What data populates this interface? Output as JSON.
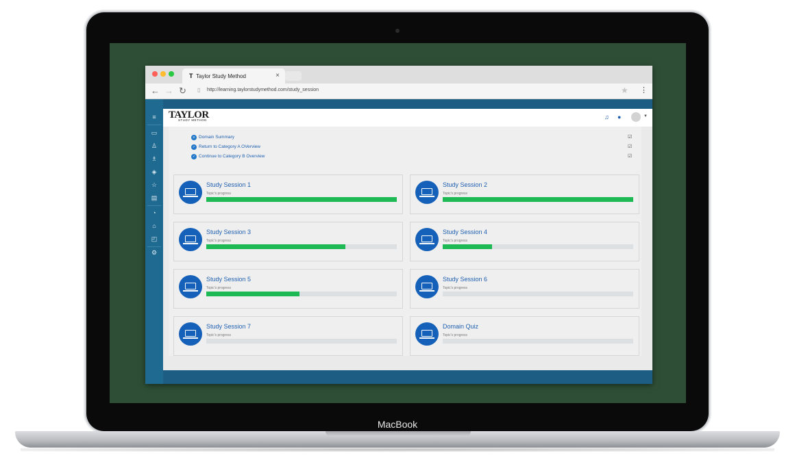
{
  "device": {
    "brand_label": "MacBook"
  },
  "browser": {
    "tab_title": "Taylor Study Method",
    "tab_icon": "T",
    "tab_close": "×",
    "url": "http://learning.taylorstudymethod.com/study_session"
  },
  "app": {
    "logo_text": "TAYLOR",
    "logo_subtitle": "STUDY METHOD",
    "links": [
      {
        "label": "Domain Summary",
        "icon": "list-icon"
      },
      {
        "label": "Return to Category A OVerview",
        "icon": "check-icon"
      },
      {
        "label": "Continue to Category B Overview",
        "icon": "check-icon"
      }
    ],
    "sessions": [
      {
        "title": "Study Session 1",
        "subtitle": "Topic's progress",
        "progress": 1.0
      },
      {
        "title": "Study Session 2",
        "subtitle": "Topic's progress",
        "progress": 1.0
      },
      {
        "title": "Study Session 3",
        "subtitle": "Topic's progress",
        "progress": 0.73
      },
      {
        "title": "Study Session 4",
        "subtitle": "Topic's progress",
        "progress": 0.26
      },
      {
        "title": "Study Session 5",
        "subtitle": "Topic's progress",
        "progress": 0.49
      },
      {
        "title": "Study Session 6",
        "subtitle": "Topic's progress",
        "progress": 0
      },
      {
        "title": "Study Session 7",
        "subtitle": "Topic's progress",
        "progress": 0
      },
      {
        "title": "Domain Quiz",
        "subtitle": "Topic's progress",
        "progress": 0
      }
    ]
  },
  "colors": {
    "sidebar": "#1e6a90",
    "accent": "#1560b8",
    "progress": "#1db954",
    "screen_bg": "#2e4f36"
  }
}
